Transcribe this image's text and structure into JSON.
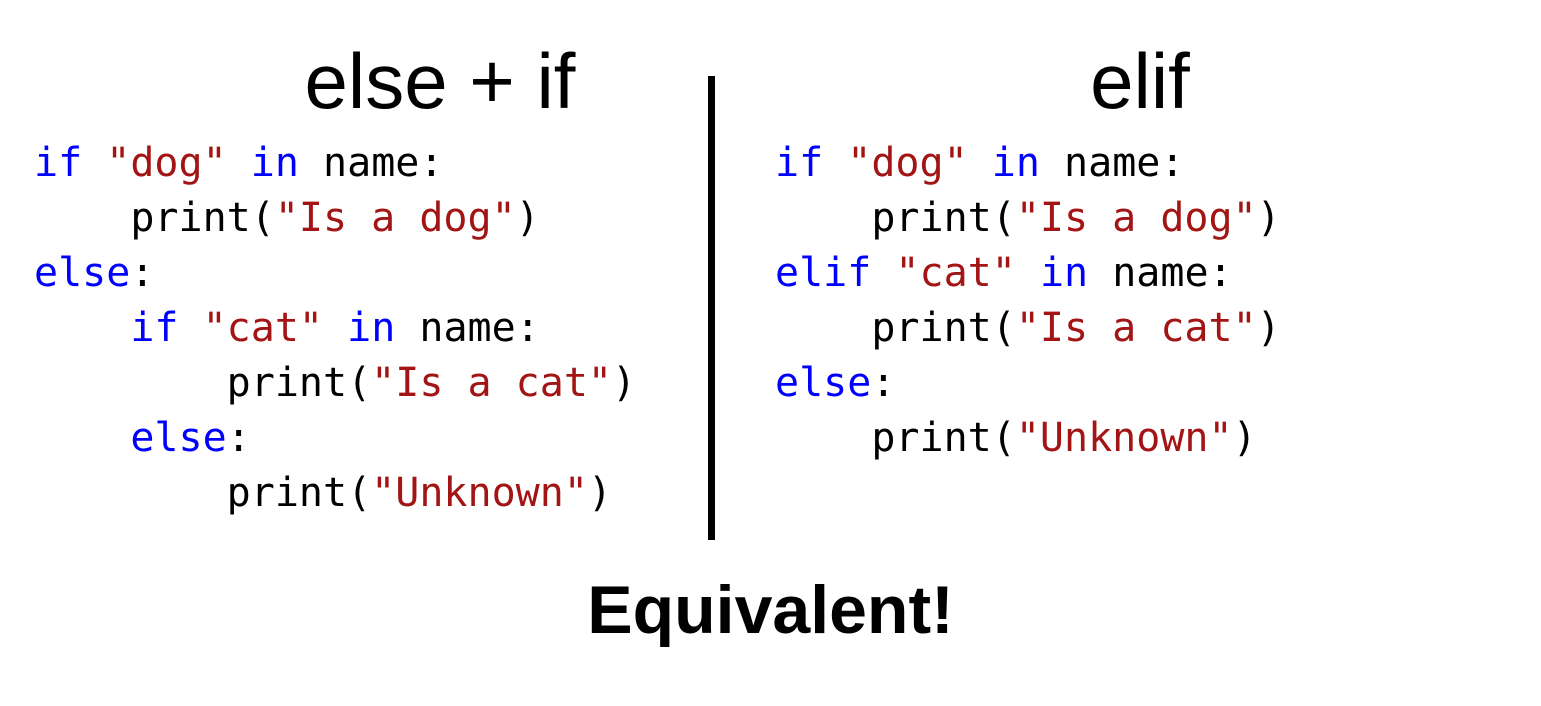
{
  "left_panel": {
    "title": "else + if",
    "code_lines": [
      [
        {
          "t": "kw",
          "v": "if"
        },
        {
          "t": "plain",
          "v": " "
        },
        {
          "t": "str",
          "v": "\"dog\""
        },
        {
          "t": "plain",
          "v": " "
        },
        {
          "t": "kw",
          "v": "in"
        },
        {
          "t": "plain",
          "v": " name:"
        }
      ],
      [
        {
          "t": "plain",
          "v": "    print("
        },
        {
          "t": "str",
          "v": "\"Is a dog\""
        },
        {
          "t": "plain",
          "v": ")"
        }
      ],
      [
        {
          "t": "kw",
          "v": "else"
        },
        {
          "t": "plain",
          "v": ":"
        }
      ],
      [
        {
          "t": "plain",
          "v": "    "
        },
        {
          "t": "kw",
          "v": "if"
        },
        {
          "t": "plain",
          "v": " "
        },
        {
          "t": "str",
          "v": "\"cat\""
        },
        {
          "t": "plain",
          "v": " "
        },
        {
          "t": "kw",
          "v": "in"
        },
        {
          "t": "plain",
          "v": " name:"
        }
      ],
      [
        {
          "t": "plain",
          "v": "        print("
        },
        {
          "t": "str",
          "v": "\"Is a cat\""
        },
        {
          "t": "plain",
          "v": ")"
        }
      ],
      [
        {
          "t": "plain",
          "v": "    "
        },
        {
          "t": "kw",
          "v": "else"
        },
        {
          "t": "plain",
          "v": ":"
        }
      ],
      [
        {
          "t": "plain",
          "v": "        print("
        },
        {
          "t": "str",
          "v": "\"Unknown\""
        },
        {
          "t": "plain",
          "v": ")"
        }
      ]
    ]
  },
  "right_panel": {
    "title": "elif",
    "code_lines": [
      [
        {
          "t": "kw",
          "v": "if"
        },
        {
          "t": "plain",
          "v": " "
        },
        {
          "t": "str",
          "v": "\"dog\""
        },
        {
          "t": "plain",
          "v": " "
        },
        {
          "t": "kw",
          "v": "in"
        },
        {
          "t": "plain",
          "v": " name:"
        }
      ],
      [
        {
          "t": "plain",
          "v": "    print("
        },
        {
          "t": "str",
          "v": "\"Is a dog\""
        },
        {
          "t": "plain",
          "v": ")"
        }
      ],
      [
        {
          "t": "kw",
          "v": "elif"
        },
        {
          "t": "plain",
          "v": " "
        },
        {
          "t": "str",
          "v": "\"cat\""
        },
        {
          "t": "plain",
          "v": " "
        },
        {
          "t": "kw",
          "v": "in"
        },
        {
          "t": "plain",
          "v": " name:"
        }
      ],
      [
        {
          "t": "plain",
          "v": "    print("
        },
        {
          "t": "str",
          "v": "\"Is a cat\""
        },
        {
          "t": "plain",
          "v": ")"
        }
      ],
      [
        {
          "t": "kw",
          "v": "else"
        },
        {
          "t": "plain",
          "v": ":"
        }
      ],
      [
        {
          "t": "plain",
          "v": "    print("
        },
        {
          "t": "str",
          "v": "\"Unknown\""
        },
        {
          "t": "plain",
          "v": ")"
        }
      ]
    ]
  },
  "footer": {
    "text": "Equivalent!"
  },
  "colors": {
    "keyword": "#0000ff",
    "string": "#a31515",
    "plain": "#000000"
  }
}
